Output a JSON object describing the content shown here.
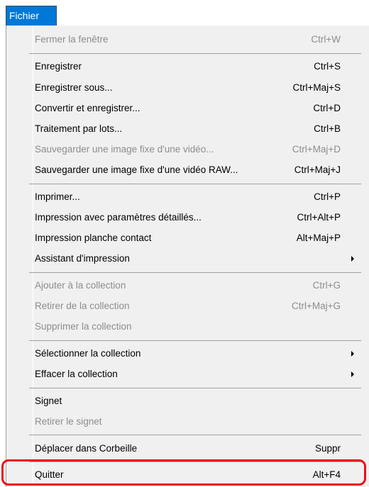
{
  "menubar": {
    "active_menu": "Fichier"
  },
  "menu": {
    "items": [
      {
        "label": "Fermer la fenêtre",
        "shortcut": "Ctrl+W",
        "enabled": false
      },
      {
        "label": "Enregistrer",
        "shortcut": "Ctrl+S",
        "enabled": true
      },
      {
        "label": "Enregistrer sous...",
        "shortcut": "Ctrl+Maj+S",
        "enabled": true
      },
      {
        "label": "Convertir et enregistrer...",
        "shortcut": "Ctrl+D",
        "enabled": true
      },
      {
        "label": "Traitement par lots...",
        "shortcut": "Ctrl+B",
        "enabled": true
      },
      {
        "label": "Sauvegarder une image fixe d'une vidéo...",
        "shortcut": "Ctrl+Maj+D",
        "enabled": false
      },
      {
        "label": "Sauvegarder une image fixe d'une vidéo RAW...",
        "shortcut": "Ctrl+Maj+J",
        "enabled": true
      },
      {
        "label": "Imprimer...",
        "shortcut": "Ctrl+P",
        "enabled": true
      },
      {
        "label": "Impression avec paramètres détaillés...",
        "shortcut": "Ctrl+Alt+P",
        "enabled": true
      },
      {
        "label": "Impression planche contact",
        "shortcut": "Alt+Maj+P",
        "enabled": true
      },
      {
        "label": "Assistant d'impression",
        "shortcut": "",
        "enabled": true,
        "submenu": true
      },
      {
        "label": "Ajouter à la collection",
        "shortcut": "Ctrl+G",
        "enabled": false
      },
      {
        "label": "Retirer de la collection",
        "shortcut": "Ctrl+Maj+G",
        "enabled": false
      },
      {
        "label": "Supprimer la collection",
        "shortcut": "",
        "enabled": false
      },
      {
        "label": "Sélectionner la collection",
        "shortcut": "",
        "enabled": true,
        "submenu": true
      },
      {
        "label": "Effacer la collection",
        "shortcut": "",
        "enabled": true,
        "submenu": true
      },
      {
        "label": "Signet",
        "shortcut": "",
        "enabled": true
      },
      {
        "label": "Retirer le signet",
        "shortcut": "",
        "enabled": false
      },
      {
        "label": "Déplacer dans Corbeille",
        "shortcut": "Suppr",
        "enabled": true
      },
      {
        "label": "Quitter",
        "shortcut": "Alt+F4",
        "enabled": true,
        "highlighted": true
      }
    ]
  },
  "colors": {
    "menubar_active_bg": "#0078d7",
    "menu_bg": "#f0f0f0",
    "disabled_text": "#8d8d8d",
    "highlight_border": "#e8101c"
  }
}
